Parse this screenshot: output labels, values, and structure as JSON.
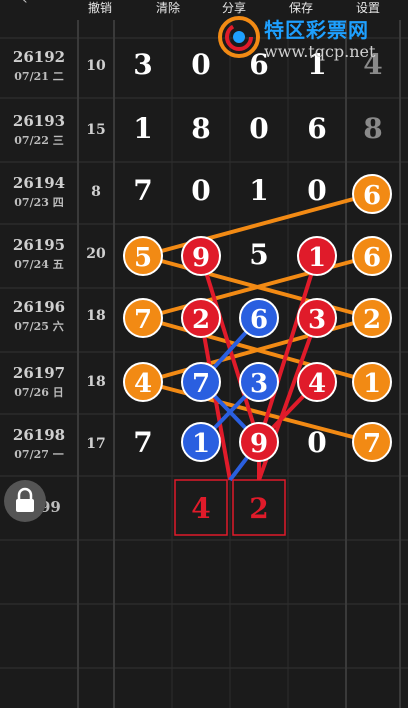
{
  "toolbar": {
    "undo": "撤销",
    "clear": "清除",
    "share": "分享",
    "save": "保存",
    "settings": "设置"
  },
  "watermark": {
    "title": "特区彩票网",
    "url": "www.tqcp.net"
  },
  "rows": [
    {
      "issue": "26192",
      "date": "07/21 二",
      "sum": "10",
      "digits": [
        "3",
        "0",
        "6",
        "1",
        "4"
      ]
    },
    {
      "issue": "26193",
      "date": "07/22 三",
      "sum": "15",
      "digits": [
        "1",
        "8",
        "0",
        "6",
        "8"
      ]
    },
    {
      "issue": "26194",
      "date": "07/23 四",
      "sum": "8",
      "digits": [
        "7",
        "0",
        "1",
        "0",
        "6"
      ]
    },
    {
      "issue": "26195",
      "date": "07/24 五",
      "sum": "20",
      "digits": [
        "5",
        "9",
        "5",
        "1",
        "6"
      ]
    },
    {
      "issue": "26196",
      "date": "07/25 六",
      "sum": "18",
      "digits": [
        "7",
        "2",
        "6",
        "3",
        "2"
      ]
    },
    {
      "issue": "26197",
      "date": "07/26 日",
      "sum": "18",
      "digits": [
        "4",
        "7",
        "3",
        "4",
        "1"
      ]
    },
    {
      "issue": "26198",
      "date": "07/27 一",
      "sum": "17",
      "digits": [
        "7",
        "1",
        "9",
        "0",
        "7"
      ]
    }
  ],
  "next_row": {
    "issue_fragment": "99",
    "predictions": [
      "4",
      "2"
    ]
  },
  "colors": {
    "orange": "#f28a14",
    "red": "#e01b2a",
    "blue": "#2a5fe0",
    "grid": "#3a3a3a",
    "background": "#1b1b1b"
  },
  "icons": {
    "back": "chevron-left-icon",
    "lock": "lock-icon",
    "logo": "spiral-logo-icon"
  }
}
